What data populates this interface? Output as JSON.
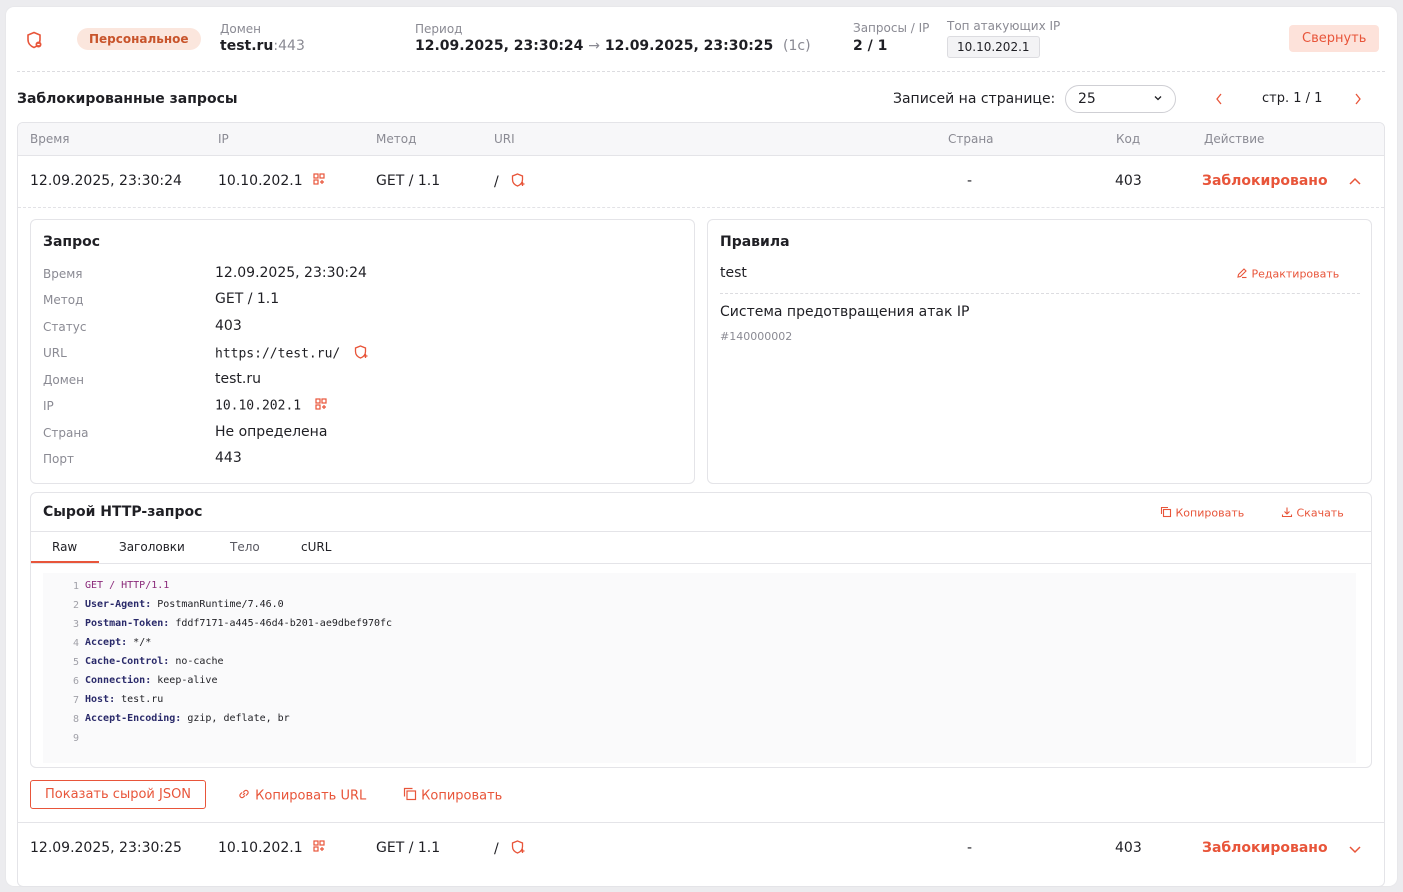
{
  "header": {
    "badge": "Персональное",
    "domain_label": "Домен",
    "domain_host": "test.ru",
    "domain_port": ":443",
    "period_label": "Период",
    "period_from": "12.09.2025, 23:30:24",
    "period_arrow": "→",
    "period_to": "12.09.2025, 23:30:25",
    "period_duration": "(1с)",
    "requests_label": "Запросы / IP",
    "requests_value": "2 / 1",
    "top_ip_label": "Топ атакующих IP",
    "top_ip_value": "10.10.202.1",
    "collapse_button": "Свернуть"
  },
  "section": {
    "title": "Заблокированные запросы",
    "per_page_label": "Записей на странице:",
    "per_page_value": "25",
    "page_info": "стр. 1 / 1"
  },
  "table": {
    "headers": [
      "Время",
      "IP",
      "Метод",
      "URI",
      "Страна",
      "Код",
      "Действие"
    ],
    "rows": [
      {
        "time": "12.09.2025, 23:30:24",
        "ip": "10.10.202.1",
        "method": "GET / 1.1",
        "uri": "/",
        "country": "-",
        "code": "403",
        "action": "Заблокировано"
      },
      {
        "time": "12.09.2025, 23:30:25",
        "ip": "10.10.202.1",
        "method": "GET / 1.1",
        "uri": "/",
        "country": "-",
        "code": "403",
        "action": "Заблокировано"
      }
    ]
  },
  "request_card": {
    "title": "Запрос",
    "fields": [
      {
        "key": "Время",
        "value": "12.09.2025, 23:30:24"
      },
      {
        "key": "Метод",
        "value": "GET / 1.1"
      },
      {
        "key": "Статус",
        "value": "403"
      },
      {
        "key": "URL",
        "value": "https://test.ru/"
      },
      {
        "key": "Домен",
        "value": "test.ru"
      },
      {
        "key": "IP",
        "value": "10.10.202.1"
      },
      {
        "key": "Страна",
        "value": "Не определена"
      },
      {
        "key": "Порт",
        "value": "443"
      }
    ]
  },
  "rules_card": {
    "title": "Правила",
    "rule_name": "test",
    "edit_label": "Редактировать",
    "system_name": "Система предотвращения атак IP",
    "system_id": "#140000002"
  },
  "raw_card": {
    "title": "Сырой HTTP-запрос",
    "copy_label": "Копировать",
    "download_label": "Скачать",
    "tabs": [
      "Raw",
      "Заголовки",
      "Тело",
      "cURL"
    ],
    "lines": [
      {
        "n": "1",
        "k": "",
        "v": "GET / HTTP/1.1"
      },
      {
        "n": "2",
        "k": "User-Agent:",
        "v": " PostmanRuntime/7.46.0"
      },
      {
        "n": "3",
        "k": "Postman-Token:",
        "v": " fddf7171-a445-46d4-b201-ae9dbef970fc"
      },
      {
        "n": "4",
        "k": "Accept:",
        "v": " */*"
      },
      {
        "n": "5",
        "k": "Cache-Control:",
        "v": " no-cache"
      },
      {
        "n": "6",
        "k": "Connection:",
        "v": " keep-alive"
      },
      {
        "n": "7",
        "k": "Host:",
        "v": " test.ru"
      },
      {
        "n": "8",
        "k": "Accept-Encoding:",
        "v": " gzip, deflate, br"
      },
      {
        "n": "9",
        "k": "",
        "v": ""
      }
    ]
  },
  "actions": {
    "show_json": "Показать сырой JSON",
    "copy_url": "Копировать URL",
    "copy": "Копировать"
  },
  "colors": {
    "accent": "#e8553a",
    "badge_bg": "#fbe6dd"
  }
}
